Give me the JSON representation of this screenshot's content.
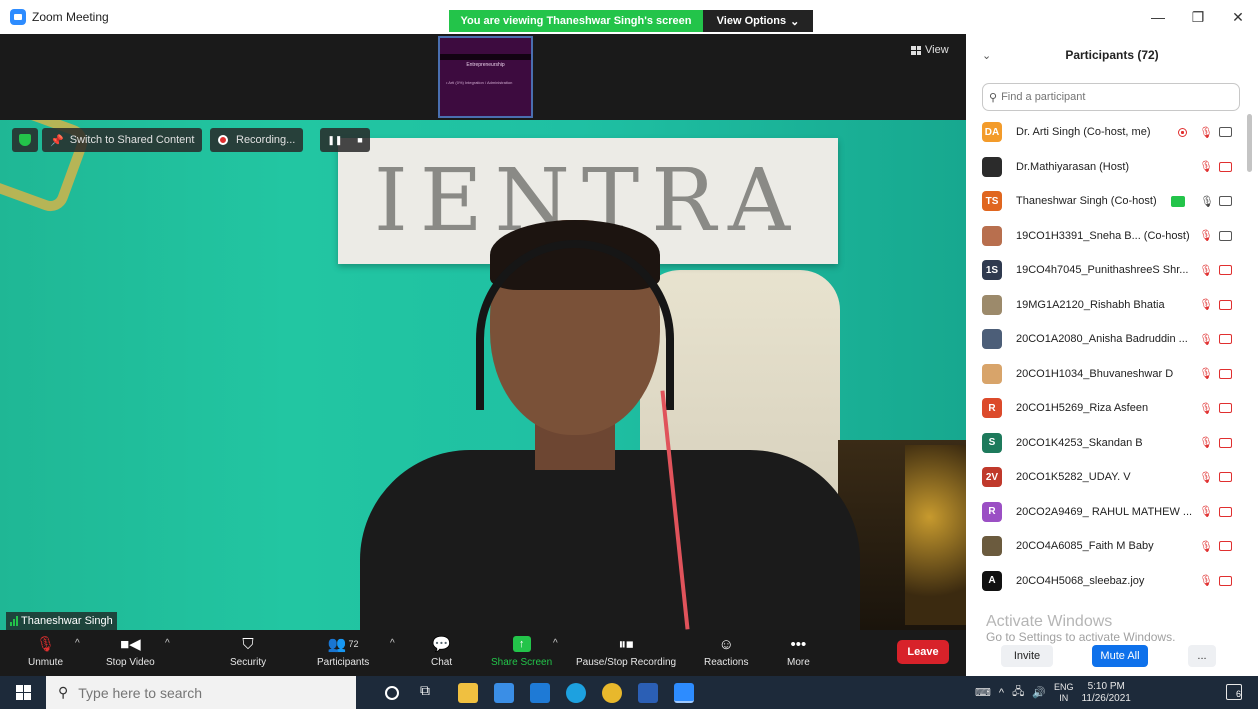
{
  "window": {
    "title": "Zoom Meeting",
    "viewing_banner": "You are viewing Thaneshwar Singh's screen",
    "view_options": "View Options",
    "view_button": "View"
  },
  "thumbnail": {
    "title": "Entrepreneurship",
    "line": "• Arti (0%) Integration / Administration"
  },
  "video": {
    "sign_text": "IENTRA",
    "switch_label": "Switch to Shared Content",
    "recording_label": "Recording...",
    "speaker_name": "Thaneshwar Singh"
  },
  "toolbar": {
    "unmute": "Unmute",
    "stop_video": "Stop Video",
    "security": "Security",
    "participants": "Participants",
    "participants_count": "72",
    "chat": "Chat",
    "share_screen": "Share Screen",
    "pause_recording": "Pause/Stop Recording",
    "reactions": "Reactions",
    "more": "More",
    "leave": "Leave"
  },
  "panel": {
    "title": "Participants (72)",
    "search_placeholder": "Find a participant",
    "participants": [
      {
        "initials": "DA",
        "color": "#f39b2a",
        "name": "Dr. Arti Singh (Co-host, me)",
        "status": "recording-mic-off-cam-on"
      },
      {
        "initials": "",
        "color": "#2b2b2b",
        "name": "Dr.Mathiyarasan (Host)",
        "status": "mic-off-cam-off"
      },
      {
        "initials": "TS",
        "color": "#e0661f",
        "name": "Thaneshwar Singh (Co-host)",
        "status": "sharing-mic-on-cam-on"
      },
      {
        "initials": "",
        "color": "#b86f4e",
        "name": "19CO1H3391_Sneha B... (Co-host)",
        "status": "mic-off-cam-on"
      },
      {
        "initials": "1S",
        "color": "#2f3a4f",
        "name": "19CO4h7045_PunithashreeS Shr...",
        "status": "mic-off-cam-off"
      },
      {
        "initials": "",
        "color": "#9c8a6b",
        "name": "19MG1A2120_Rishabh Bhatia",
        "status": "mic-off-cam-off"
      },
      {
        "initials": "",
        "color": "#4c5e78",
        "name": "20CO1A2080_Anisha Badruddin ...",
        "status": "mic-off-cam-off"
      },
      {
        "initials": "",
        "color": "#d8a46a",
        "name": "20CO1H1034_Bhuvaneshwar D",
        "status": "mic-off-cam-off"
      },
      {
        "initials": "R",
        "color": "#dc4a2b",
        "name": "20CO1H5269_Riza Asfeen",
        "status": "mic-off-cam-off"
      },
      {
        "initials": "S",
        "color": "#1e7a5c",
        "name": "20CO1K4253_Skandan B",
        "status": "mic-off-cam-off"
      },
      {
        "initials": "2V",
        "color": "#c0392b",
        "name": "20CO1K5282_UDAY. V",
        "status": "mic-off-cam-off"
      },
      {
        "initials": "R",
        "color": "#9b4fc4",
        "name": "20CO2A9469_ RAHUL MATHEW ...",
        "status": "mic-off-cam-off"
      },
      {
        "initials": "",
        "color": "#6b5b3e",
        "name": "20CO4A6085_Faith M Baby",
        "status": "mic-off-cam-off"
      },
      {
        "initials": "A",
        "color": "#111111",
        "name": "20CO4H5068_sleebaz.joy",
        "status": "mic-off-cam-off"
      }
    ],
    "invite": "Invite",
    "mute_all": "Mute All",
    "more": "..."
  },
  "watermark": {
    "line1": "Activate Windows",
    "line2": "Go to Settings to activate Windows."
  },
  "taskbar": {
    "search_placeholder": "Type here to search",
    "lang_top": "ENG",
    "lang_bottom": "IN",
    "time": "5:10 PM",
    "date": "11/26/2021",
    "notif_count": "6"
  }
}
